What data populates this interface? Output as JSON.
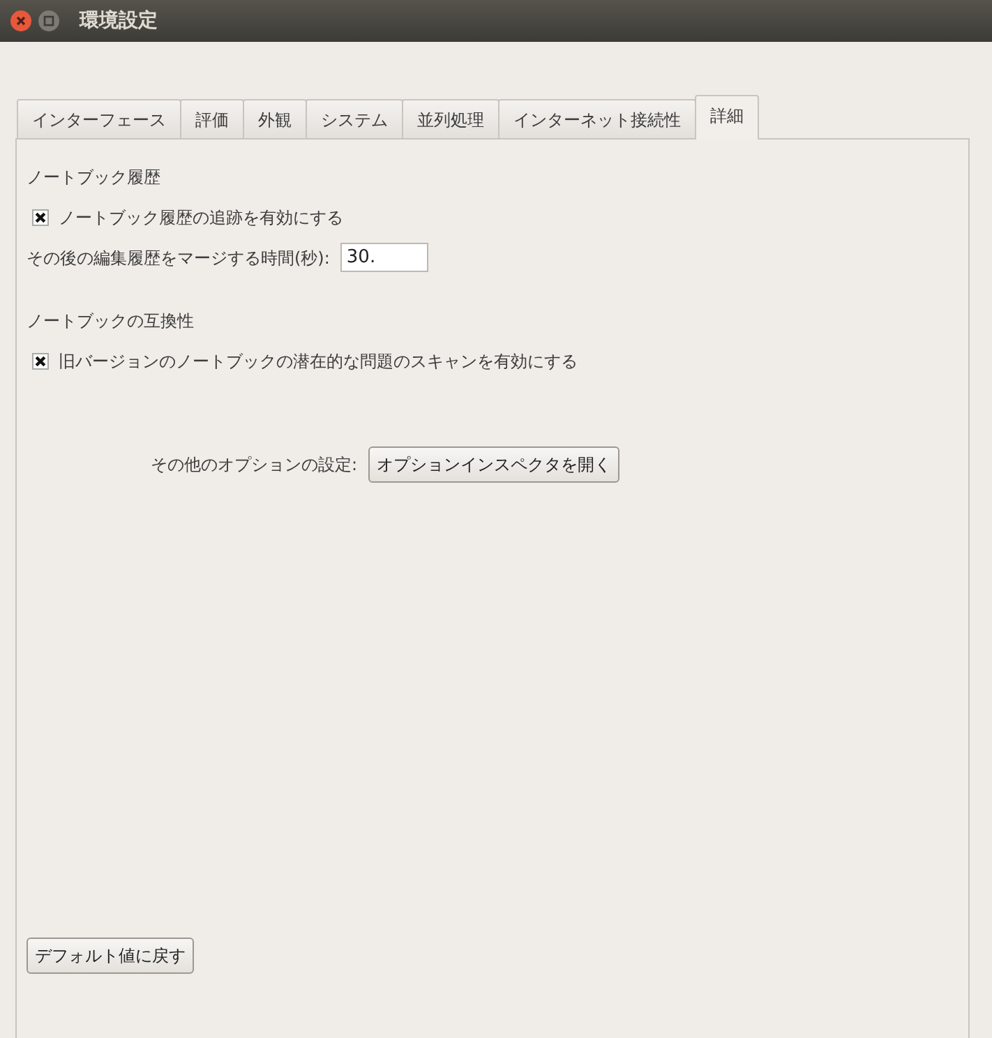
{
  "window": {
    "title": "環境設定"
  },
  "tabs": [
    {
      "label": "インターフェース",
      "selected": false
    },
    {
      "label": "評価",
      "selected": false
    },
    {
      "label": "外観",
      "selected": false
    },
    {
      "label": "システム",
      "selected": false
    },
    {
      "label": "並列処理",
      "selected": false
    },
    {
      "label": "インターネット接続性",
      "selected": false
    },
    {
      "label": "詳細",
      "selected": true
    }
  ],
  "sections": [
    {
      "heading": "ノートブック履歴",
      "checkbox": {
        "label": "ノートブック履歴の追跡を有効にする",
        "checked": true
      },
      "field": {
        "label": "その後の編集履歴をマージする時間(秒):",
        "value": "30."
      }
    },
    {
      "heading": "ノートブックの互換性",
      "checkbox": {
        "label": "旧バージョンのノートブックの潜在的な問題のスキャンを有効にする",
        "checked": true
      }
    }
  ],
  "options_row": {
    "label": "その他のオプションの設定:",
    "button": "オプションインスペクタを開く"
  },
  "reset_button": "デフォルト値に戻す"
}
